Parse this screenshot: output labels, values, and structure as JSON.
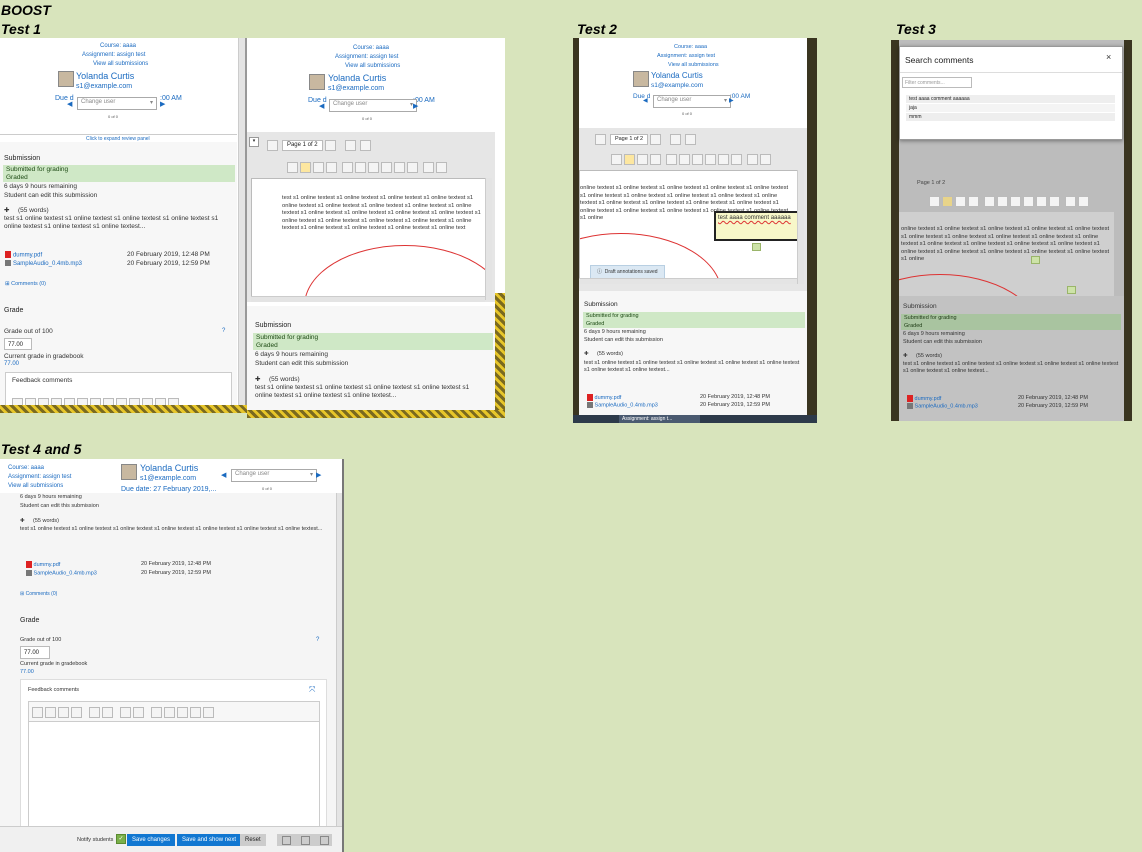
{
  "headings": {
    "boost": "BOOST",
    "test1": "Test 1",
    "test2": "Test 2",
    "test3": "Test 3",
    "test45": "Test 4 and 5"
  },
  "grader": {
    "course": "Course: aaaa",
    "assignment": "Assignment: assign test",
    "view_all": "View all submissions",
    "user_name": "Yolanda Curtis",
    "user_email": "s1@example.com",
    "due_short": "Due d",
    "due_time": ":00 AM",
    "due_full": "Due date: 27 February 2019,...",
    "change_user": "Change user",
    "count": "0 of 0",
    "expand_review": "Click to expand review panel",
    "page": "Page 1 of 2",
    "page_short": "Page 1 of 2"
  },
  "submission": {
    "heading": "Submission",
    "status_submitted": "Submitted for grading",
    "status_graded": "Graded",
    "remaining": "6 days 9 hours remaining",
    "can_edit": "Student can edit this submission",
    "words": "(55 words)",
    "online_text": "test s1 online textest s1 online textest s1 online textest s1 online textest s1 online textest s1 online textest s1 online textest...",
    "files": [
      {
        "name": "dummy.pdf",
        "date": "20 February 2019, 12:48 PM"
      },
      {
        "name": "SampleAudio_0.4mb.mp3",
        "date": "20 February 2019, 12:59 PM"
      }
    ],
    "comments": "Comments (0)"
  },
  "grade": {
    "heading": "Grade",
    "out_of": "Grade out of 100",
    "value": "77.00",
    "current": "Current grade in gradebook",
    "current_value": "77.00",
    "feedback": "Feedback comments"
  },
  "pdf_text": {
    "p1": "test s1 online textest s1 online textest s1 online textest s1 online textest s1 online textest s1 online textest s1 online textest s1 online textest s1 online textest s1 online textest s1 online textest s1 online textest s1 online textest s1 online textest s1 online textest s1 online textest s1 online textest s1 online textest s1 online textest s1 online textest s1 online textest s1 online text",
    "p2": "online textest s1 online textest s1 online textest s1 online textest s1 online textest s1 online textest s1 online textest s1 online textest s1 online textest s1 online textest s1 online textest s1 online textest s1 online textest s1 online textest s1 online textest s1 online textest s1 online textest s1 online textest s1 online textest s1 online"
  },
  "test2": {
    "comment_text": "test aaaa comment aaaaaa",
    "saved": "Draft annotations saved",
    "taskbar": "Assignment: assign t..."
  },
  "test3": {
    "title": "Search comments",
    "close": "×",
    "filter_placeholder": "Filter comments...",
    "results": [
      "test aaaa comment aaaaaa",
      "jaja",
      "mmm"
    ],
    "page": "Page 1 of 2"
  },
  "footer": {
    "notify": "Notify students",
    "save": "Save changes",
    "save_next": "Save and show next",
    "reset": "Reset"
  }
}
